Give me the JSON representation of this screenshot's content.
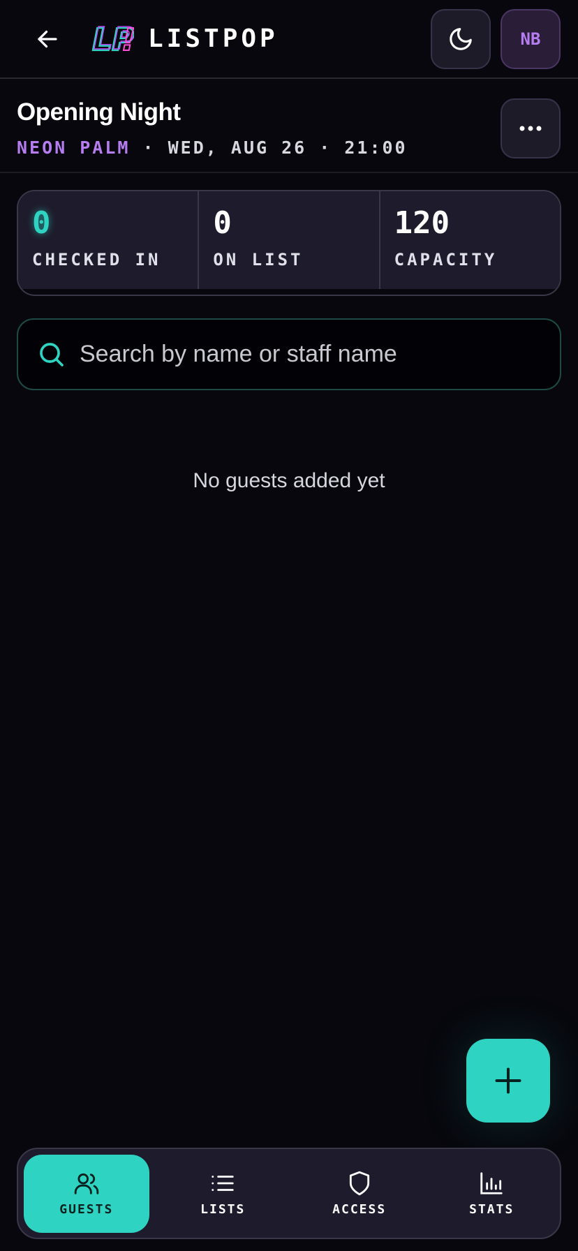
{
  "header": {
    "back_icon": "arrow-left-icon",
    "logo_text": "LP!",
    "brand": "LISTPOP",
    "theme_icon": "moon-icon",
    "avatar_initials": "NB"
  },
  "event": {
    "title": "Opening Night",
    "venue": "NEON PALM",
    "meta": "· WED, AUG 26 · 21:00",
    "more_icon": "more-horizontal-icon"
  },
  "stats": [
    {
      "value": "0",
      "label": "CHECKED IN"
    },
    {
      "value": "0",
      "label": "ON LIST"
    },
    {
      "value": "120",
      "label": "CAPACITY"
    }
  ],
  "search": {
    "placeholder": "Search by name or staff name",
    "value": "",
    "icon": "search-icon"
  },
  "empty_state": "No guests added yet",
  "fab": {
    "icon": "plus-icon"
  },
  "nav": [
    {
      "label": "GUESTS",
      "icon": "users-icon",
      "active": true
    },
    {
      "label": "LISTS",
      "icon": "list-icon",
      "active": false
    },
    {
      "label": "ACCESS",
      "icon": "shield-icon",
      "active": false
    },
    {
      "label": "STATS",
      "icon": "bar-chart-icon",
      "active": false
    }
  ],
  "colors": {
    "accent": "#2ed3c1",
    "purple": "#b57df0",
    "background": "#07070d",
    "surface": "#1e1c2c"
  }
}
